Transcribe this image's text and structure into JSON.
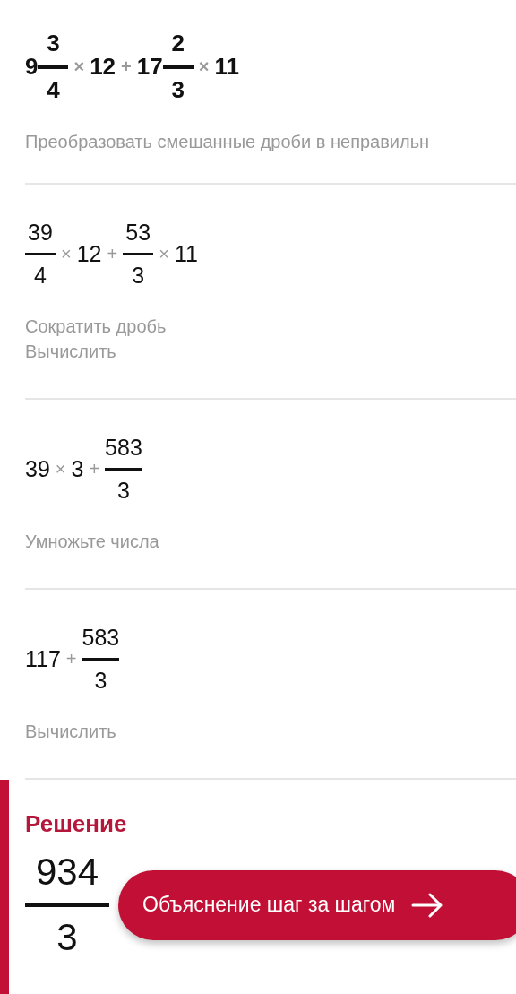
{
  "steps": [
    {
      "bold": true,
      "expression": [
        {
          "kind": "mixed",
          "whole": "9",
          "numerator": "3",
          "denominator": "4"
        },
        {
          "kind": "op",
          "text": "×"
        },
        {
          "kind": "number",
          "text": "12"
        },
        {
          "kind": "op",
          "text": "+"
        },
        {
          "kind": "mixed",
          "whole": "17",
          "numerator": "2",
          "denominator": "3"
        },
        {
          "kind": "op",
          "text": "×"
        },
        {
          "kind": "number",
          "text": "11"
        }
      ],
      "notes": [
        "Преобразовать смешанные дроби в неправильн"
      ]
    },
    {
      "bold": false,
      "expression": [
        {
          "kind": "fraction",
          "numerator": "39",
          "denominator": "4"
        },
        {
          "kind": "op",
          "text": "×"
        },
        {
          "kind": "number",
          "text": "12"
        },
        {
          "kind": "op",
          "text": "+"
        },
        {
          "kind": "fraction",
          "numerator": "53",
          "denominator": "3"
        },
        {
          "kind": "op",
          "text": "×"
        },
        {
          "kind": "number",
          "text": "11"
        }
      ],
      "notes": [
        "Сократить дробь",
        "Вычислить"
      ]
    },
    {
      "bold": false,
      "expression": [
        {
          "kind": "number",
          "text": "39"
        },
        {
          "kind": "op",
          "text": "×"
        },
        {
          "kind": "number",
          "text": "3"
        },
        {
          "kind": "op",
          "text": "+"
        },
        {
          "kind": "fraction",
          "numerator": "583",
          "denominator": "3"
        }
      ],
      "notes": [
        "Умножьте числа"
      ]
    },
    {
      "bold": false,
      "expression": [
        {
          "kind": "number",
          "text": "117"
        },
        {
          "kind": "op",
          "text": "+"
        },
        {
          "kind": "fraction",
          "numerator": "583",
          "denominator": "3"
        }
      ],
      "notes": [
        "Вычислить"
      ]
    }
  ],
  "solution": {
    "title": "Решение",
    "result": {
      "numerator": "934",
      "denominator": "3"
    },
    "button": "Объяснение шаг за шагом"
  }
}
